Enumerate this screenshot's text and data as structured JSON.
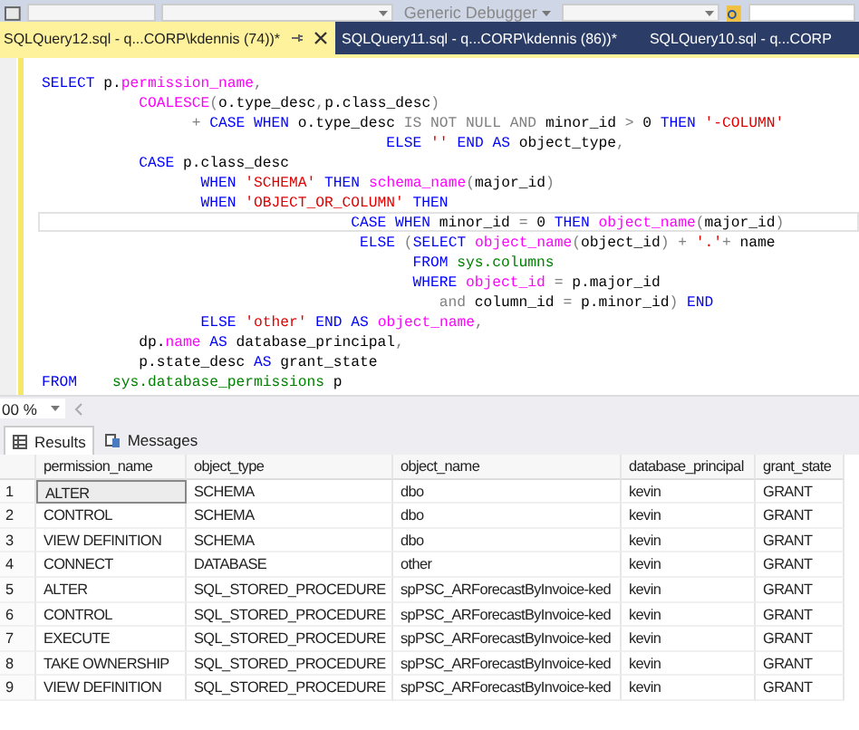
{
  "toolbar": {
    "debugger": "Generic Debugger"
  },
  "tabs": [
    {
      "label": "SQLQuery12.sql - q...CORP\\kdennis (74))*",
      "selected": true
    },
    {
      "label": "SQLQuery11.sql - q...CORP\\kdennis (86))*",
      "selected": false
    },
    {
      "label": "SQLQuery10.sql - q...CORP",
      "selected": false
    }
  ],
  "editor": {
    "lines": [
      {
        "current": false,
        "tokens": [
          {
            "kind": "keyword",
            "text": "SELECT"
          },
          {
            "kind": "plain",
            "text": " p."
          },
          {
            "kind": "function",
            "text": "permission_name"
          },
          {
            "kind": "gray",
            "text": ","
          }
        ]
      },
      {
        "current": false,
        "tokens": [
          {
            "kind": "function",
            "text": "           COALESCE"
          },
          {
            "kind": "gray",
            "text": "("
          },
          {
            "kind": "plain",
            "text": "o.type_desc"
          },
          {
            "kind": "gray",
            "text": ","
          },
          {
            "kind": "plain",
            "text": "p.class_desc"
          },
          {
            "kind": "gray",
            "text": ")"
          }
        ]
      },
      {
        "current": false,
        "tokens": [
          {
            "kind": "gray",
            "text": "                 +"
          },
          {
            "kind": "keyword",
            "text": " CASE WHEN"
          },
          {
            "kind": "plain",
            "text": " o.type_desc "
          },
          {
            "kind": "gray",
            "text": "IS NOT NULL AND"
          },
          {
            "kind": "plain",
            "text": " minor_id "
          },
          {
            "kind": "gray",
            "text": ">"
          },
          {
            "kind": "plain",
            "text": " 0 "
          },
          {
            "kind": "keyword",
            "text": "THEN"
          },
          {
            "kind": "string",
            "text": " '-COLUMN'"
          }
        ]
      },
      {
        "current": false,
        "tokens": [
          {
            "kind": "keyword",
            "text": "                                       ELSE"
          },
          {
            "kind": "string",
            "text": " ''"
          },
          {
            "kind": "keyword",
            "text": " END AS"
          },
          {
            "kind": "plain",
            "text": " object_type"
          },
          {
            "kind": "gray",
            "text": ","
          }
        ]
      },
      {
        "current": false,
        "tokens": [
          {
            "kind": "keyword",
            "text": "           CASE"
          },
          {
            "kind": "plain",
            "text": " p.class_desc"
          }
        ]
      },
      {
        "current": false,
        "tokens": [
          {
            "kind": "keyword",
            "text": "                  WHEN"
          },
          {
            "kind": "string",
            "text": " 'SCHEMA'"
          },
          {
            "kind": "keyword",
            "text": " THEN"
          },
          {
            "kind": "function",
            "text": " schema_name"
          },
          {
            "kind": "gray",
            "text": "("
          },
          {
            "kind": "plain",
            "text": "major_id"
          },
          {
            "kind": "gray",
            "text": ")"
          }
        ]
      },
      {
        "current": false,
        "tokens": [
          {
            "kind": "keyword",
            "text": "                  WHEN"
          },
          {
            "kind": "string",
            "text": " 'OBJECT_OR_COLUMN'"
          },
          {
            "kind": "keyword",
            "text": " THEN"
          }
        ]
      },
      {
        "current": true,
        "tokens": [
          {
            "kind": "keyword",
            "text": "                                   CASE WHEN"
          },
          {
            "kind": "plain",
            "text": " minor_id "
          },
          {
            "kind": "gray",
            "text": "="
          },
          {
            "kind": "plain",
            "text": " 0 "
          },
          {
            "kind": "keyword",
            "text": "THEN"
          },
          {
            "kind": "function",
            "text": " object_name"
          },
          {
            "kind": "gray",
            "text": "("
          },
          {
            "kind": "plain",
            "text": "major_id"
          },
          {
            "kind": "gray",
            "text": ")"
          }
        ]
      },
      {
        "current": false,
        "tokens": [
          {
            "kind": "keyword",
            "text": "                                    ELSE"
          },
          {
            "kind": "gray",
            "text": " ("
          },
          {
            "kind": "keyword",
            "text": "SELECT"
          },
          {
            "kind": "function",
            "text": " object_name"
          },
          {
            "kind": "gray",
            "text": "("
          },
          {
            "kind": "plain",
            "text": "object_id"
          },
          {
            "kind": "gray",
            "text": ") +"
          },
          {
            "kind": "string",
            "text": " '.'"
          },
          {
            "kind": "gray",
            "text": "+"
          },
          {
            "kind": "plain",
            "text": " name"
          }
        ]
      },
      {
        "current": false,
        "tokens": [
          {
            "kind": "keyword",
            "text": "                                          FROM"
          },
          {
            "kind": "system",
            "text": " sys.columns"
          }
        ]
      },
      {
        "current": false,
        "tokens": [
          {
            "kind": "keyword",
            "text": "                                          WHERE"
          },
          {
            "kind": "function",
            "text": " object_id"
          },
          {
            "kind": "gray",
            "text": " ="
          },
          {
            "kind": "plain",
            "text": " p.major_id"
          }
        ]
      },
      {
        "current": false,
        "tokens": [
          {
            "kind": "gray",
            "text": "                                             and"
          },
          {
            "kind": "plain",
            "text": " column_id "
          },
          {
            "kind": "gray",
            "text": "="
          },
          {
            "kind": "plain",
            "text": " p.minor_id"
          },
          {
            "kind": "gray",
            "text": ")"
          },
          {
            "kind": "keyword",
            "text": " END"
          }
        ]
      },
      {
        "current": false,
        "tokens": [
          {
            "kind": "keyword",
            "text": "                  ELSE"
          },
          {
            "kind": "string",
            "text": " 'other'"
          },
          {
            "kind": "keyword",
            "text": " END AS"
          },
          {
            "kind": "function",
            "text": " object_name"
          },
          {
            "kind": "gray",
            "text": ","
          }
        ]
      },
      {
        "current": false,
        "tokens": [
          {
            "kind": "plain",
            "text": "           dp."
          },
          {
            "kind": "function",
            "text": "name"
          },
          {
            "kind": "keyword",
            "text": " AS"
          },
          {
            "kind": "plain",
            "text": " database_principal"
          },
          {
            "kind": "gray",
            "text": ","
          }
        ]
      },
      {
        "current": false,
        "tokens": [
          {
            "kind": "plain",
            "text": "           p.state_desc "
          },
          {
            "kind": "keyword",
            "text": "AS"
          },
          {
            "kind": "plain",
            "text": " grant_state"
          }
        ]
      },
      {
        "current": false,
        "tokens": [
          {
            "kind": "keyword",
            "text": "FROM"
          },
          {
            "kind": "system",
            "text": "    sys.database_permissions"
          },
          {
            "kind": "plain",
            "text": " p"
          }
        ]
      }
    ]
  },
  "zoom": "00 %",
  "result_tabs": [
    {
      "label": "Results",
      "selected": true
    },
    {
      "label": "Messages",
      "selected": false
    }
  ],
  "table": {
    "columns": [
      "permission_name",
      "object_type",
      "object_name",
      "database_principal",
      "grant_state"
    ],
    "rows": [
      {
        "number": "1",
        "cells": [
          "ALTER",
          "SCHEMA",
          "dbo",
          "kevin",
          "GRANT"
        ],
        "selected_cell": true
      },
      {
        "number": "2",
        "cells": [
          "CONTROL",
          "SCHEMA",
          "dbo",
          "kevin",
          "GRANT"
        ],
        "selected_cell": false
      },
      {
        "number": "3",
        "cells": [
          "VIEW DEFINITION",
          "SCHEMA",
          "dbo",
          "kevin",
          "GRANT"
        ],
        "selected_cell": false
      },
      {
        "number": "4",
        "cells": [
          "CONNECT",
          "DATABASE",
          "other",
          "kevin",
          "GRANT"
        ],
        "selected_cell": false
      },
      {
        "number": "5",
        "cells": [
          "ALTER",
          "SQL_STORED_PROCEDURE",
          "spPSC_ARForecastByInvoice-ked",
          "kevin",
          "GRANT"
        ],
        "selected_cell": false
      },
      {
        "number": "6",
        "cells": [
          "CONTROL",
          "SQL_STORED_PROCEDURE",
          "spPSC_ARForecastByInvoice-ked",
          "kevin",
          "GRANT"
        ],
        "selected_cell": false
      },
      {
        "number": "7",
        "cells": [
          "EXECUTE",
          "SQL_STORED_PROCEDURE",
          "spPSC_ARForecastByInvoice-ked",
          "kevin",
          "GRANT"
        ],
        "selected_cell": false
      },
      {
        "number": "8",
        "cells": [
          "TAKE OWNERSHIP",
          "SQL_STORED_PROCEDURE",
          "spPSC_ARForecastByInvoice-ked",
          "kevin",
          "GRANT"
        ],
        "selected_cell": false
      },
      {
        "number": "9",
        "cells": [
          "VIEW DEFINITION",
          "SQL_STORED_PROCEDURE",
          "spPSC_ARForecastByInvoice-ked",
          "kevin",
          "GRANT"
        ],
        "selected_cell": false
      }
    ]
  }
}
